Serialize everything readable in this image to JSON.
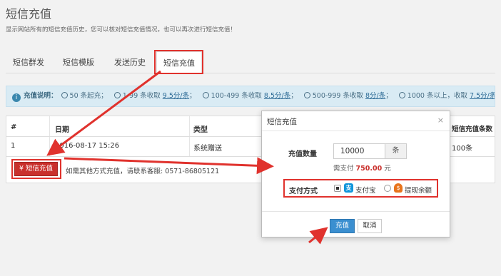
{
  "page": {
    "title": "短信充值",
    "description": "显示网站所有的短信充值历史，您可以核对短信充值情况，也可以再次进行短信充值！"
  },
  "tabs": [
    {
      "label": "短信群发"
    },
    {
      "label": "短信模版"
    },
    {
      "label": "发送历史"
    },
    {
      "label": "短信充值"
    }
  ],
  "info_bar": {
    "icon": "info-icon",
    "lead": "充值说明：",
    "items": [
      {
        "prefix": "50 条起充；",
        "link": ""
      },
      {
        "prefix": "1-99 条收取 ",
        "link": "9.5分/条",
        "suffix": "；"
      },
      {
        "prefix": "100-499 条收取 ",
        "link": "8.5分/条",
        "suffix": "；"
      },
      {
        "prefix": "500-999 条收取 ",
        "link": "8分/条",
        "suffix": "；"
      },
      {
        "prefix": "1000 条以上，收取 ",
        "link": "7.5分/条",
        "suffix": "；"
      }
    ]
  },
  "table": {
    "headers": [
      "#",
      "日期",
      "类型",
      "短信充值条数"
    ],
    "rows": [
      [
        "1",
        "2016-08-17 15:26",
        "系统赠送",
        "100条"
      ]
    ]
  },
  "recharge_button": "¥ 短信充值",
  "contact_text": "如需其他方式充值，请联系客服: 0571-86805121",
  "modal": {
    "title": "短信充值",
    "close": "×",
    "qty_label": "充值数量",
    "qty_value": "10000",
    "qty_unit": "条",
    "pay_note_prefix": "需支付",
    "pay_amount": "750.00",
    "pay_note_suffix": "元",
    "pay_method_label": "支付方式",
    "options": [
      {
        "label": "支付宝",
        "icon": "alipay-icon",
        "checked": true
      },
      {
        "label": "提现余额",
        "icon": "wallet-icon",
        "checked": false
      }
    ],
    "submit": "充值",
    "cancel": "取消"
  },
  "colors": {
    "annotation_red": "#e0322d",
    "primary_blue": "#3b8fd0",
    "danger_red": "#c9302c"
  }
}
